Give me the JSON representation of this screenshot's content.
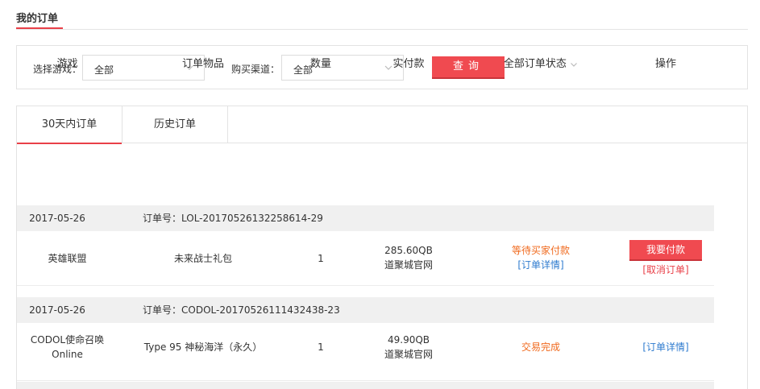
{
  "header": {
    "title": "我的订单"
  },
  "filters": {
    "game_label": "选择游戏：",
    "game_value": "全部",
    "channel_label": "购买渠道：",
    "channel_value": "全部",
    "query_label": "查询"
  },
  "tabs": [
    {
      "label": "30天内订单",
      "active": true
    },
    {
      "label": "历史订单",
      "active": false
    }
  ],
  "columns": {
    "game": "游戏",
    "item": "订单物品",
    "qty": "数量",
    "paid": "实付款",
    "status": "全部订单状态",
    "action": "操作"
  },
  "orders": [
    {
      "date": "2017-05-26",
      "order_no": "订单号：LOL-20170526132258614-29",
      "game": "英雄联盟",
      "item": "未来战士礼包",
      "qty": "1",
      "price": "285.60QB",
      "channel": "道聚城官网",
      "status": "等待买家付款",
      "status_link": "[订单详情]",
      "action_button": "我要付款",
      "action_link": "[取消订单]"
    },
    {
      "date": "2017-05-26",
      "order_no": "订单号：CODOL-20170526111432438-23",
      "game_line1": "CODOL使命召唤",
      "game_line2": "Online",
      "item": "Type 95 神秘海洋（永久）",
      "qty": "1",
      "price": "49.90QB",
      "channel": "道聚城官网",
      "status": "交易完成",
      "action_link": "[订单详情]"
    }
  ],
  "colors": {
    "accent": "#f04a50",
    "status_orange": "#f06a1e",
    "link_blue": "#2e7bcf"
  }
}
